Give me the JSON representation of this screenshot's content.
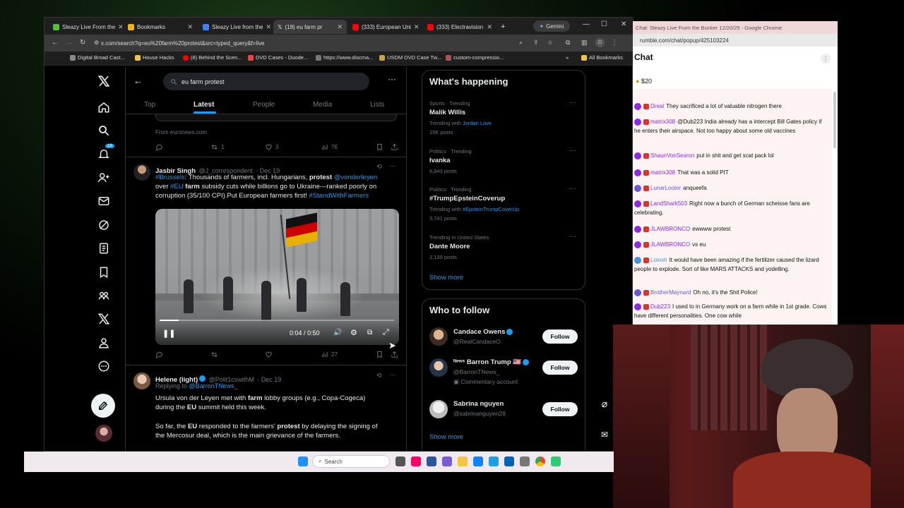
{
  "browser": {
    "tabs": [
      {
        "label": "Sleazy Live From the",
        "icon_color": "#53c22b"
      },
      {
        "label": "Bookmarks",
        "icon_color": "#f4b400"
      },
      {
        "label": "Sleazy Live from the",
        "icon_color": "#3b82f6"
      },
      {
        "label": "(18) eu farm pr",
        "icon_color": "#ffffff"
      },
      {
        "label": "(333) European Uni",
        "icon_color": "#ff0000"
      },
      {
        "label": "(333) Electravision",
        "icon_color": "#ff0000"
      }
    ],
    "new_tab": "+",
    "gemini_label": "Gemini",
    "url": "x.com/search?q=eu%20farm%20protest&src=typed_query&f=live",
    "profile_initial": "D",
    "bookmarks": [
      "Digital Broad Cast...",
      "House Hacks",
      "(8) Behind the Scen...",
      "DVD Cases - Duode...",
      "https://www.discma...",
      "USDM DVD Case Tw...",
      "custom-compressio..."
    ],
    "all_bookmarks": "All Bookmarks"
  },
  "x": {
    "search_query": "eu farm protest",
    "tabs": [
      "Top",
      "Latest",
      "People",
      "Media",
      "Lists"
    ],
    "notif_count": "18",
    "prev_tweet": {
      "source": "From euronews.com",
      "retweets": "1",
      "likes": "3",
      "views": "76"
    },
    "tweet1": {
      "name": "Jasbir Singh",
      "handle": "@J_correspondent",
      "date": "· Dec 19",
      "text_l1_tag": "#Brussels",
      "text_l1": ": Thousands of farmers, incl. Hungarians, ",
      "text_l1_bold": "protest",
      "text_l1_mention": " @vonderleyen",
      "text_l2_pre": " over ",
      "text_l2_tag": "#EU",
      "text_l2_bold": " farm",
      "text_l2": " subsidy cuts while billions go to Ukraine—ranked poorly on",
      "text_l3": "corruption (35/100 CPI).Put European farmers first! ",
      "text_l3_tag": "#StandWithFarmers",
      "video_time": "0:04 / 0:50",
      "video_progress": 0.08,
      "views": "27"
    },
    "tweet2": {
      "name": "Helene (light)",
      "handle": "@Polit1cswithM",
      "date": "· Dec 19",
      "replying_label": "Replying to ",
      "replying_to": "@BarronTNews_",
      "line1_pre": "Ursula von der Leyen met with ",
      "line1_bold": "farm",
      "line1_post": " lobby groups (e.g., Copa-Cogeca)",
      "line2_pre": "during the ",
      "line2_bold": "EU",
      "line2_post": " summit held this week.",
      "line3_pre": "So far, the ",
      "line3_bold": "EU",
      "line3_mid": " responded to the farmers' ",
      "line3_bold2": "protest",
      "line3_post": " by delaying the signing of",
      "line4": "the Mercosur deal, which is the main grievance of the farmers."
    },
    "happening": {
      "title": "What's happening",
      "trends": [
        {
          "meta": "Sports · Trending",
          "name": "Malik Willis",
          "with_label": "Trending with ",
          "with": "Jordan Love",
          "posts": "15K posts"
        },
        {
          "meta": "Politics · Trending",
          "name": "Ivanka",
          "posts": "6,843 posts"
        },
        {
          "meta": "Politics · Trending",
          "name": "#TrumpEpsteinCoverup",
          "with_label": "Trending with ",
          "with": "#EpsteinTrumpCoverUp",
          "posts": "3,741 posts"
        },
        {
          "meta": "Trending in United States",
          "name": "Dante Moore",
          "posts": "2,139 posts"
        }
      ],
      "show_more": "Show more"
    },
    "who_to_follow": {
      "title": "Who to follow",
      "accounts": [
        {
          "name": "Candace Owens",
          "handle": "@RealCandaceO",
          "extra": ""
        },
        {
          "name": "ᴺᵉʷˢ Barron Trump 🇺🇸",
          "handle": "@BarronTNews_",
          "extra": "Commentary account"
        },
        {
          "name": "Sabrina nguyen",
          "handle": "@sabrinanguyen28",
          "extra": ""
        }
      ],
      "follow_label": "Follow",
      "show_more": "Show more"
    }
  },
  "chat": {
    "window_title": "Chat: Sleazy Live From the Bunker 12/20/25 - Google Chrome",
    "url": "rumble.com/chat/popup/425103224",
    "title": "Chat",
    "tip": "$20",
    "messages": [
      {
        "user": "Dreal",
        "color": "#8a2be2",
        "text": "They sacrificed a lot of valuable nitrogen there"
      },
      {
        "user": "matrix308",
        "color": "#8a2be2",
        "text": "@Dub223 India already has a intercept Bill Gates policy if he enters their airspace. Not too happy about some old vaccines"
      },
      {
        "user": "ShaunVonSexron",
        "color": "#8a2be2",
        "text": "put in shit and get scat pack lol"
      },
      {
        "user": "matrix308",
        "color": "#8a2be2",
        "text": "That was a solid PIT"
      },
      {
        "user": "LunarLooter",
        "color": "#6a5acd",
        "text": "anqueefa"
      },
      {
        "user": "LandShark503",
        "color": "#8a2be2",
        "text": "Right now a bunch of German scheisse fans are celebrating."
      },
      {
        "user": "JLAWBRONCO",
        "color": "#8a2be2",
        "text": "ewwww protest"
      },
      {
        "user": "JLAWBRONCO",
        "color": "#8a2be2",
        "text": "vs eu"
      },
      {
        "user": "Loiosh",
        "color": "#4a90d9",
        "text": "It would have been amazing if the fertilizer caused the lizard people to explode. Sort of like MARS ATTACKS and yodelling."
      },
      {
        "user": "BrotherMaynard",
        "color": "#6a5acd",
        "text": "Oh no, it's the Shit Police!"
      },
      {
        "user": "Dub223",
        "color": "#8a2be2",
        "text": "I used to in Germany work on a farm while in 1st grade. Cows have different personalities. One cow while"
      }
    ]
  },
  "taskbar": {
    "search_label": "Search"
  }
}
